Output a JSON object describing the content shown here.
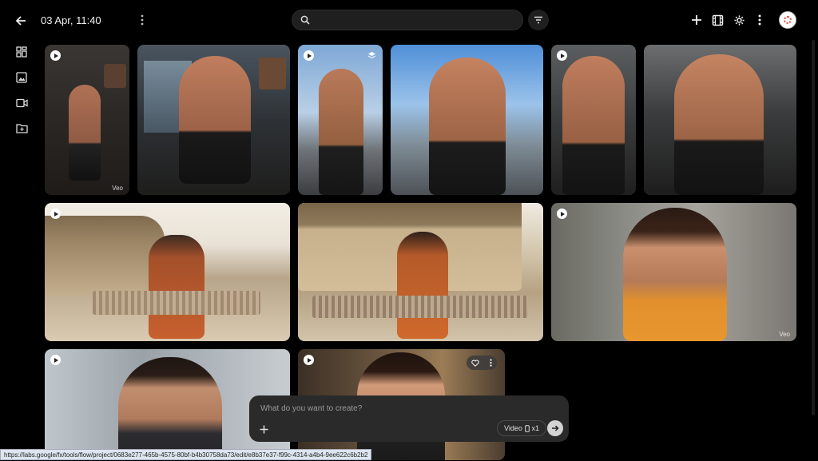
{
  "header": {
    "timestamp": "03 Apr, 11:40",
    "icons": [
      "back-arrow-icon",
      "more-vertical-icon",
      "search-icon",
      "filter-icon",
      "plus-icon",
      "film-icon",
      "gear-icon",
      "more-vertical-icon"
    ]
  },
  "search": {
    "value": "",
    "placeholder": ""
  },
  "sidebar": {
    "items": [
      {
        "icon": "grid-view-icon"
      },
      {
        "icon": "image-icon"
      },
      {
        "icon": "video-icon"
      },
      {
        "icon": "add-folder-icon"
      }
    ]
  },
  "gallery": {
    "veo_badge": "Veo"
  },
  "composer": {
    "placeholder": "What do you want to create?",
    "mode_label": "Video",
    "count_label": "x1"
  },
  "status_bar": {
    "url": "https://labs.google/fx/tools/flow/project/0683e277-465b-4575-80bf-b4b30758da73/edit/e8b37e37-f99c-4314-a4b4-9ee622c6b2b2"
  },
  "colors": {
    "background": "#000000",
    "panel": "#2a2a2a",
    "search_bg": "#1f1f1f"
  }
}
